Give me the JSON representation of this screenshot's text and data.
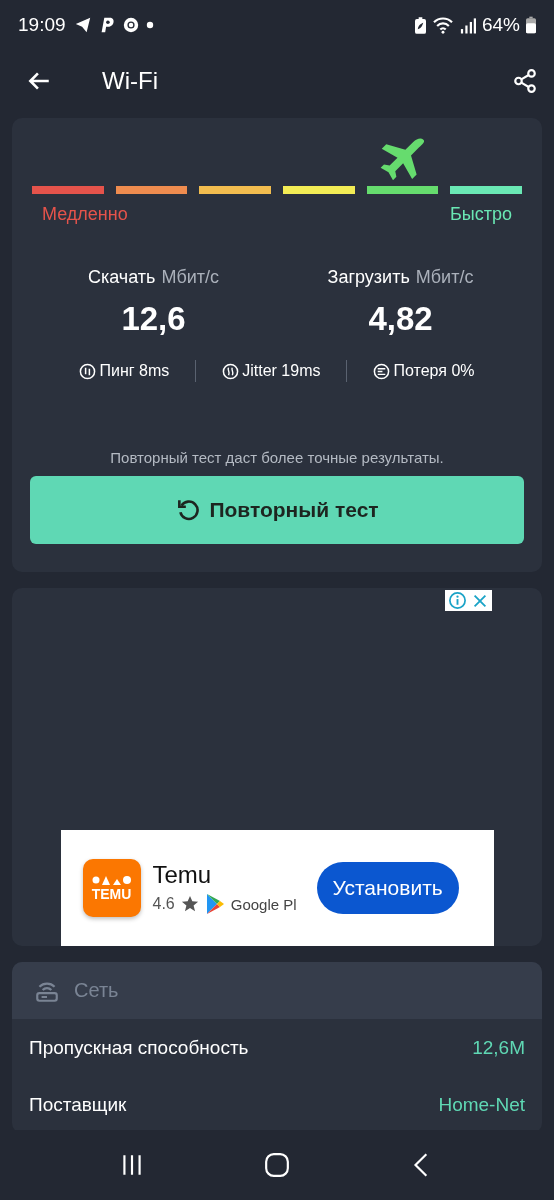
{
  "status_bar": {
    "time": "19:09",
    "battery": "64%"
  },
  "app_bar": {
    "title": "Wi-Fi"
  },
  "speed_scale": {
    "segments": [
      {
        "color": "#e5534b",
        "selected": false
      },
      {
        "color": "#ef8c4f",
        "selected": false
      },
      {
        "color": "#f2bd4f",
        "selected": false
      },
      {
        "color": "#f3ec55",
        "selected": false
      },
      {
        "color": "#66dc6e",
        "selected": true
      },
      {
        "color": "#6ae8b4",
        "selected": false
      }
    ],
    "slow_label": "Медленно",
    "fast_label": "Быстро"
  },
  "results": [
    {
      "label": "Скачать",
      "unit": "Мбит/с",
      "value": "12,6"
    },
    {
      "label": "Загрузить",
      "unit": "Мбит/с",
      "value": "4,82"
    }
  ],
  "metrics": [
    {
      "kind": "ping",
      "text": "Пинг 8ms"
    },
    {
      "kind": "jitter",
      "text": "Jitter 19ms"
    },
    {
      "kind": "loss",
      "text": "Потеря 0%"
    }
  ],
  "hint": "Повторный тест даст более точные результаты.",
  "retest_button": "Повторный тест",
  "ad": {
    "app_name": "Temu",
    "logo_text": "TEMU",
    "rating": "4.6",
    "store": "Google Pl",
    "button": "Установить"
  },
  "network": {
    "title": "Сеть",
    "rows": [
      {
        "label": "Пропускная способность",
        "value": "12,6M"
      },
      {
        "label": "Поставщик",
        "value": "Home-Net"
      }
    ]
  }
}
